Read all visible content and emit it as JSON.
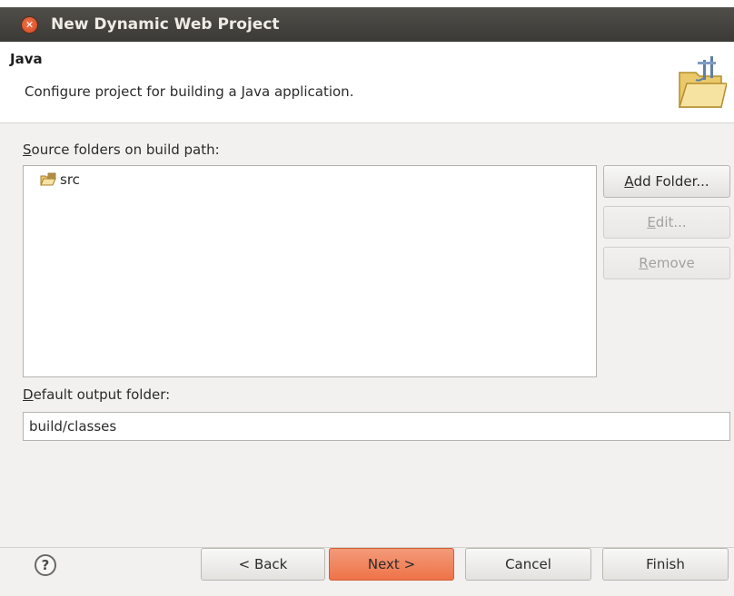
{
  "window": {
    "title": "New Dynamic Web Project"
  },
  "header": {
    "title": "Java",
    "description": "Configure project for building a Java application.",
    "icon": "java-folder-icon"
  },
  "source_folders": {
    "label_mnemonic": "S",
    "label_rest": "ource folders on build path:",
    "items": [
      {
        "label": "src",
        "icon": "source-folder-icon"
      }
    ]
  },
  "side_buttons": {
    "add_folder": {
      "mnemonic": "A",
      "rest": "dd Folder...",
      "enabled": true
    },
    "edit": {
      "mnemonic": "E",
      "rest": "dit...",
      "enabled": false
    },
    "remove": {
      "mnemonic": "R",
      "rest": "emove",
      "enabled": false
    }
  },
  "output_folder": {
    "label_mnemonic": "D",
    "label_rest": "efault output folder:",
    "value": "build/classes"
  },
  "footer": {
    "help_glyph": "?",
    "back": "< Back",
    "next": "Next >",
    "cancel": "Cancel",
    "finish": "Finish"
  },
  "colors": {
    "titlebar": "#3f3e3a",
    "primary_button": "#ef7a50",
    "content_bg": "#f2f1f0"
  }
}
